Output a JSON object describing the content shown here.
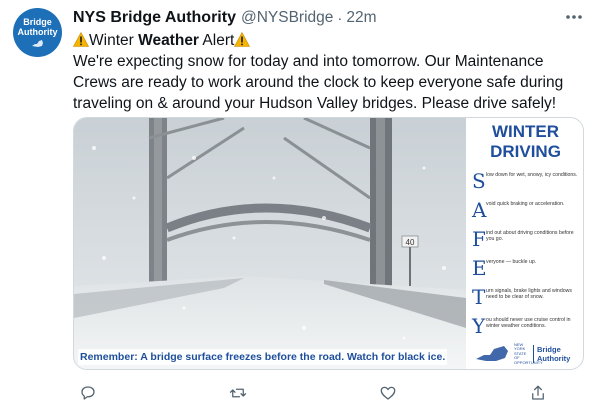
{
  "account": {
    "avatar_text": "Bridge Authority",
    "name": "NYS Bridge Authority",
    "handle": "@NYSBridge",
    "separator": "·",
    "time": "22m"
  },
  "tweet": {
    "line1_pre": "Winter ",
    "line1_bold": "Weather",
    "line1_post": " Alert",
    "body": "We're expecting snow for today and into tomorrow. Our Maintenance Crews are ready to work around the clock to keep everyone safe during traveling on & around your Hudson Valley bridges. Please drive safely!"
  },
  "media": {
    "sign_speed": "40",
    "title_line1": "WINTER",
    "title_line2": "DRIVING",
    "safety": [
      {
        "letter": "S",
        "text": "low down for wet, snowy, icy conditions."
      },
      {
        "letter": "A",
        "text": "void quick braking or acceleration."
      },
      {
        "letter": "F",
        "text": "ind out about driving conditions before you go."
      },
      {
        "letter": "E",
        "text": "veryone — buckle up."
      },
      {
        "letter": "T",
        "text": "urn signals, brake lights and windows need to be clear of snow."
      },
      {
        "letter": "Y",
        "text": "ou should never use cruise control in winter weather conditions."
      }
    ],
    "ny_text": "NEW YORK STATE OF OPPORTUNITY",
    "brand_line1": "Bridge",
    "brand_line2": "Authority",
    "caption": "Remember:  A bridge surface freezes before the road. Watch for black ice."
  },
  "colors": {
    "brand_blue": "#1f4e9c",
    "avatar_blue": "#1d6fb8",
    "muted": "#536471",
    "text": "#0f1419",
    "warning_yellow": "#f5b400"
  },
  "icons": [
    "more-icon",
    "warning-icon",
    "reply-icon",
    "retweet-icon",
    "like-icon",
    "share-icon"
  ]
}
